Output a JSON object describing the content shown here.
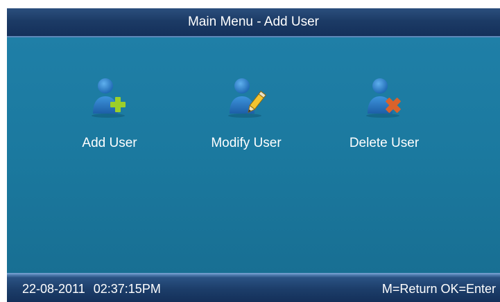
{
  "header": {
    "title": "Main Menu - Add User"
  },
  "menu": {
    "items": [
      {
        "label": "Add User",
        "icon": "add-user-icon"
      },
      {
        "label": "Modify User",
        "icon": "modify-user-icon"
      },
      {
        "label": "Delete User",
        "icon": "delete-user-icon"
      }
    ]
  },
  "status": {
    "date": "22-08-2011",
    "time": "02:37:15PM",
    "hint": "M=Return OK=Enter"
  },
  "colors": {
    "title_bar": "#1c3b66",
    "content_bg": "#1b799f",
    "status_bar": "#1c3d69",
    "user_icon": "#2b7fc8",
    "plus_icon": "#9ccf2a",
    "pencil_icon": "#f4c430",
    "delete_icon": "#d9622b",
    "text": "#ffffff"
  }
}
